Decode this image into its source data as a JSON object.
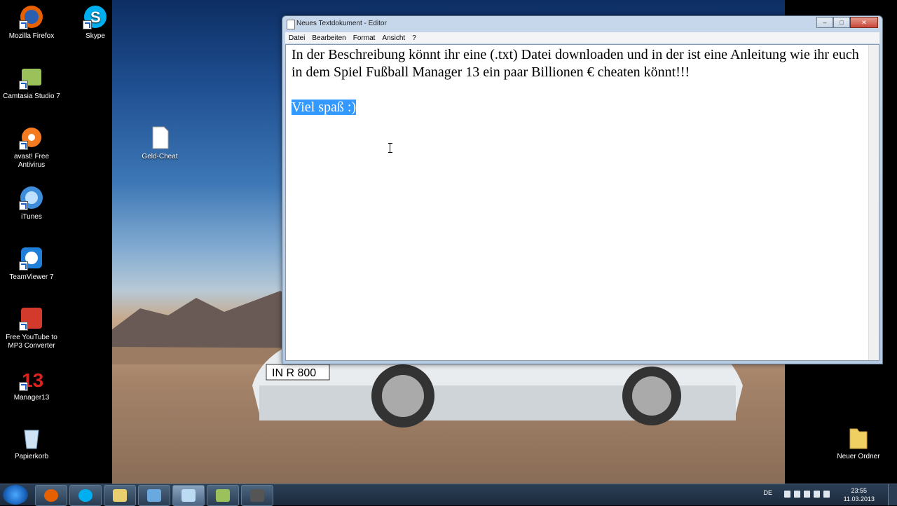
{
  "desktop": {
    "icons_left": [
      {
        "label": "Mozilla Firefox",
        "icon": "firefox-icon"
      },
      {
        "label": "Camtasia Studio 7",
        "icon": "camtasia-icon"
      },
      {
        "label": "avast! Free Antivirus",
        "icon": "avast-icon"
      },
      {
        "label": "iTunes",
        "icon": "itunes-icon"
      },
      {
        "label": "TeamViewer 7",
        "icon": "teamviewer-icon"
      },
      {
        "label": "Free YouTube to MP3 Converter",
        "icon": "youtube-mp3-icon"
      },
      {
        "label": "Manager13",
        "icon": "manager13-icon"
      },
      {
        "label": "Papierkorb",
        "icon": "recycle-bin-icon"
      }
    ],
    "icon_skype": {
      "label": "Skype",
      "icon": "skype-icon"
    },
    "icon_geld": {
      "label": "Geld-Cheat",
      "icon": "text-file-icon"
    },
    "icon_folder": {
      "label": "Neuer Ordner",
      "icon": "folder-icon"
    },
    "wallpaper_plate": "IN R 800"
  },
  "notepad": {
    "title": "Neues Textdokument - Editor",
    "menu": [
      "Datei",
      "Bearbeiten",
      "Format",
      "Ansicht",
      "?"
    ],
    "line1": "In der Beschreibung könnt ihr eine (.txt) Datei downloaden und in der ist eine Anleitung wie ihr euch in dem Spiel Fußball Manager 13 ein paar Billionen € cheaten könnt!!!",
    "line2_selected": "Viel spaß :)"
  },
  "taskbar": {
    "apps": [
      "firefox-icon",
      "skype-icon",
      "explorer-icon",
      "media-icon",
      "notepad-icon",
      "camtasia-icon",
      "recorder-icon"
    ],
    "language": "DE",
    "time": "23:55",
    "date": "11.03.2013"
  },
  "colors": {
    "selection": "#3399ff",
    "taskbar": "#1c2b3d"
  }
}
